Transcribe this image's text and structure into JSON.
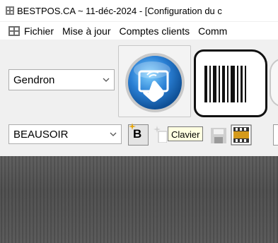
{
  "window": {
    "title": "BESTPOS.CA ~ 11-déc-2024 - [Configuration du c"
  },
  "menu": {
    "items": [
      "Fichier",
      "Mise à jour",
      "Comptes clients",
      "Comm"
    ]
  },
  "toolbar": {
    "agent_select_value": "Gendron",
    "store_select_value": "BEAUSOIR",
    "bold_label": "B",
    "tooltip_text": "Clavier"
  },
  "colors": {
    "tooltip_bg": "#ffffe1",
    "clavier_blue": "#2a7fd4",
    "content_dark": "#505050"
  },
  "icons": {
    "clavier": "touch-screen-hand-icon",
    "barcode": "barcode-icon",
    "save": "floppy-disk-icon",
    "film": "film-clapper-icon"
  }
}
